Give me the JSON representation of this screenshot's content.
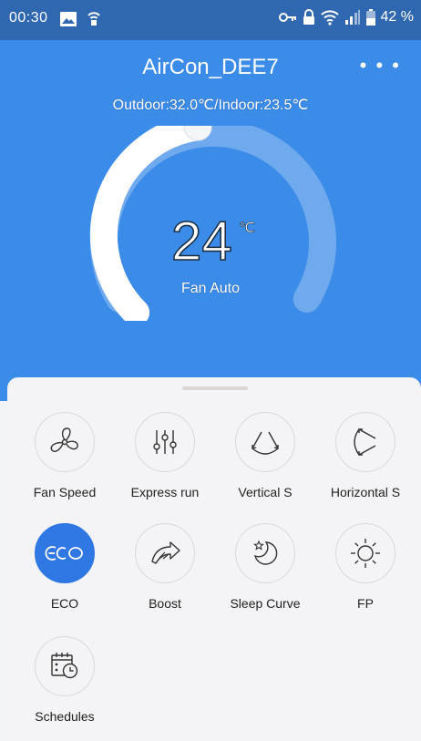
{
  "status": {
    "time": "00:30",
    "battery": "42 %"
  },
  "header": {
    "device_name": "AirCon_DEE7",
    "more_label": "• • •",
    "outdoor_indoor": "Outdoor:32.0℃/Indoor:23.5℃"
  },
  "dial": {
    "temperature": "24",
    "unit": "℃",
    "fan_mode": "Fan Auto",
    "level_fraction": 0.47
  },
  "controls": [
    {
      "label": "Fan Speed",
      "icon": "fan-icon",
      "active": false
    },
    {
      "label": "Express run",
      "icon": "sliders-icon",
      "active": false
    },
    {
      "label": "Vertical S",
      "icon": "vertical-swing-icon",
      "active": false
    },
    {
      "label": "Horizontal S",
      "icon": "horizontal-swing-icon",
      "active": false
    },
    {
      "label": "ECO",
      "icon": "eco-icon",
      "active": true
    },
    {
      "label": "Boost",
      "icon": "boost-icon",
      "active": false
    },
    {
      "label": "Sleep Curve",
      "icon": "sleep-curve-icon",
      "active": false
    },
    {
      "label": "FP",
      "icon": "sun-icon",
      "active": false
    },
    {
      "label": "Schedules",
      "icon": "schedule-icon",
      "active": false
    }
  ],
  "colors": {
    "header_bg": "#3b8be8",
    "status_bg": "#2f68b0",
    "accent": "#2f78e3"
  }
}
